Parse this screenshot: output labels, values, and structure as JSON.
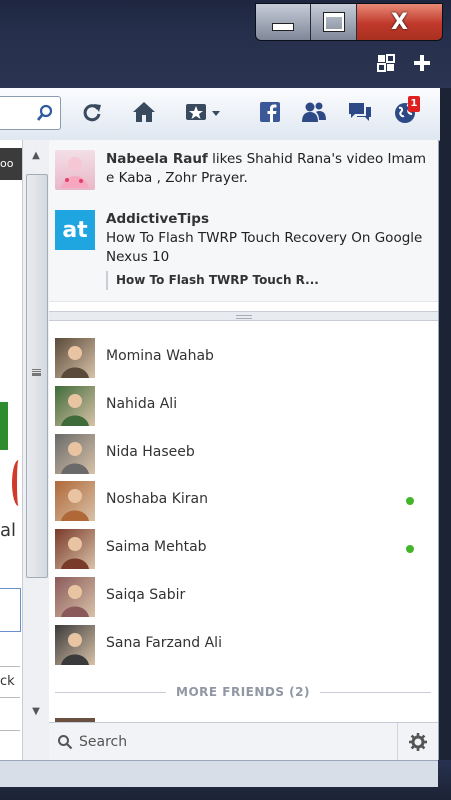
{
  "window": {
    "minimize_label": "Minimize",
    "maximize_label": "Maximize",
    "close_label": "X"
  },
  "toolbar": {
    "notification_count": "1"
  },
  "page": {
    "tab_text": "oo",
    "side_letter_1": "l",
    "side_letter_2": "al",
    "side_letter_3": "ck"
  },
  "news": [
    {
      "author": "Nabeela Rauf",
      "text": " likes Shahid Rana's video Imam e Kaba , Zohr Prayer."
    },
    {
      "author": "AddictiveTips",
      "avatar_text": "at",
      "text": "How To Flash TWRP Touch Recovery On Google Nexus 10",
      "link_title": "How To Flash TWRP Touch R..."
    }
  ],
  "friends": [
    {
      "name": "Momina Wahab",
      "online": false,
      "color": "#5a4a3a"
    },
    {
      "name": "Nahida Ali",
      "online": false,
      "color": "#3f6b3a"
    },
    {
      "name": "Nida Haseeb",
      "online": false,
      "color": "#6a6a6a"
    },
    {
      "name": "Noshaba Kiran",
      "online": true,
      "color": "#b06838"
    },
    {
      "name": "Saima Mehtab",
      "online": true,
      "color": "#7a3a2a"
    },
    {
      "name": "Saiqa Sabir",
      "online": false,
      "color": "#8a5a5a"
    },
    {
      "name": "Sana Farzand Ali",
      "online": false,
      "color": "#3a3a3a"
    }
  ],
  "more_friends": "MORE FRIENDS (2)",
  "search": {
    "placeholder": "Search"
  },
  "colors": {
    "accent": "#3b5998",
    "online": "#42b72a",
    "badge": "#e02020"
  }
}
